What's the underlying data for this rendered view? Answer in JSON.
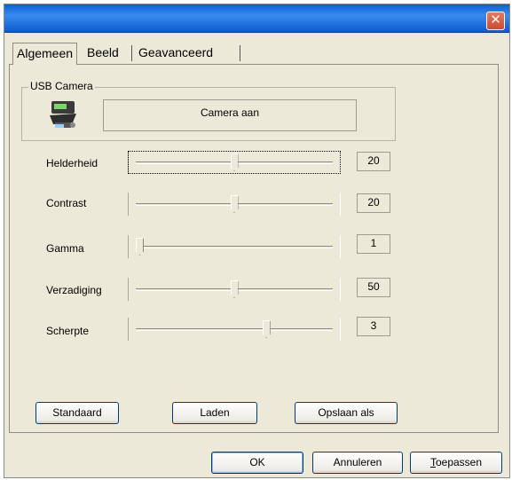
{
  "window": {
    "close_glyph": "✕"
  },
  "tabs": [
    {
      "label": "Algemeen",
      "active": true
    },
    {
      "label": "Beeld",
      "active": false
    },
    {
      "label": "Geavanceerd",
      "active": false
    }
  ],
  "camera_group": {
    "title": "USB Camera",
    "icon": "webcam-icon",
    "status": "Camera aan"
  },
  "sliders": [
    {
      "label": "Helderheid",
      "value": "20",
      "position": 0.5
    },
    {
      "label": "Contrast",
      "value": "20",
      "position": 0.5
    },
    {
      "label": "Gamma",
      "value": "1",
      "position": 0.0
    },
    {
      "label": "Verzadiging",
      "value": "50",
      "position": 0.5
    },
    {
      "label": "Scherpte",
      "value": "3",
      "position": 0.67
    }
  ],
  "panel_buttons": {
    "default": "Standaard",
    "load": "Laden",
    "save_as": "Opslaan als"
  },
  "dialog_buttons": {
    "ok": "OK",
    "cancel": "Annuleren",
    "apply": "Toepassen"
  },
  "colors": {
    "title_bar": "#0a5fd6",
    "close_button": "#d04a2c",
    "dialog_background": "#ece9d8"
  }
}
